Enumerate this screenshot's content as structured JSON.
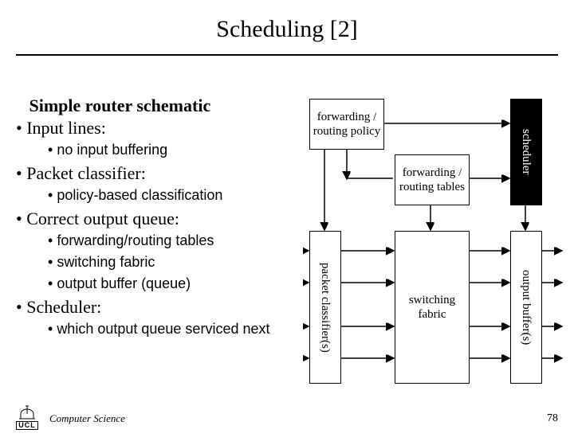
{
  "title": "Scheduling [2]",
  "outline": {
    "heading": "Simple router schematic",
    "input_lines": "Input lines:",
    "no_input_buffering": "no input buffering",
    "packet_classifier": "Packet classifier:",
    "policy_based": "policy-based classification",
    "correct_output": "Correct output queue:",
    "fwd_tables": "forwarding/routing tables",
    "switching_fabric": "switching fabric",
    "output_buffer": "output buffer (queue)",
    "scheduler": "Scheduler:",
    "which_queue": "which output queue serviced next"
  },
  "diagram": {
    "policy": "forwarding / routing policy",
    "tables": "forwarding / routing tables",
    "scheduler": "scheduler",
    "classifier": "packet classifier(s)",
    "fabric": "switching fabric",
    "output": "output buffer(s)"
  },
  "footer": {
    "logo_text": "UCL",
    "dept": "Computer Science",
    "page": "78"
  }
}
